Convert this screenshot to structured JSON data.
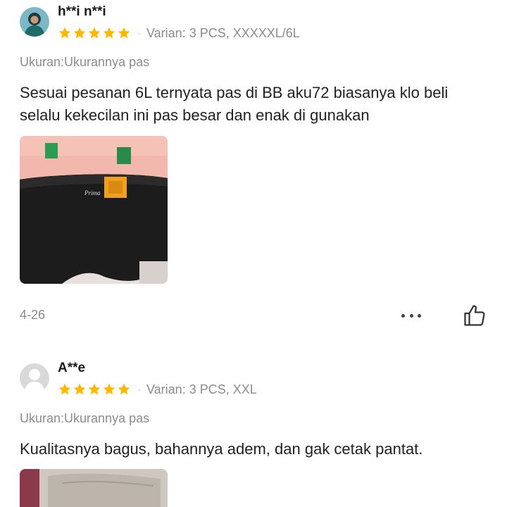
{
  "reviews": [
    {
      "username": "h**i n**i",
      "rating": 5,
      "separator": "·",
      "variant": "Varian: 3 PCS, XXXXXL/6L",
      "size_fit": "Ukuran:Ukurannya pas",
      "text": "Sesuai pesanan 6L ternyata pas di BB aku72 biasanya klo beli selalu kekecilan ini pas besar dan enak di gunakan",
      "date": "4-26",
      "avatar_icon": "user-photo-avatar-icon",
      "more_icon": "ellipsis-icon",
      "like_icon": "thumbs-up-icon"
    },
    {
      "username": "A**e",
      "rating": 5,
      "separator": "·",
      "variant": "Varian: 3 PCS, XXL",
      "size_fit": "Ukuran:Ukurannya pas",
      "text": "Kualitasnya bagus, bahannya adem, dan gak cetak pantat.",
      "avatar_icon": "default-user-avatar-icon"
    }
  ],
  "colors": {
    "star": "#FFB800",
    "muted_text": "#8c8c8c",
    "body_text": "#222222"
  }
}
